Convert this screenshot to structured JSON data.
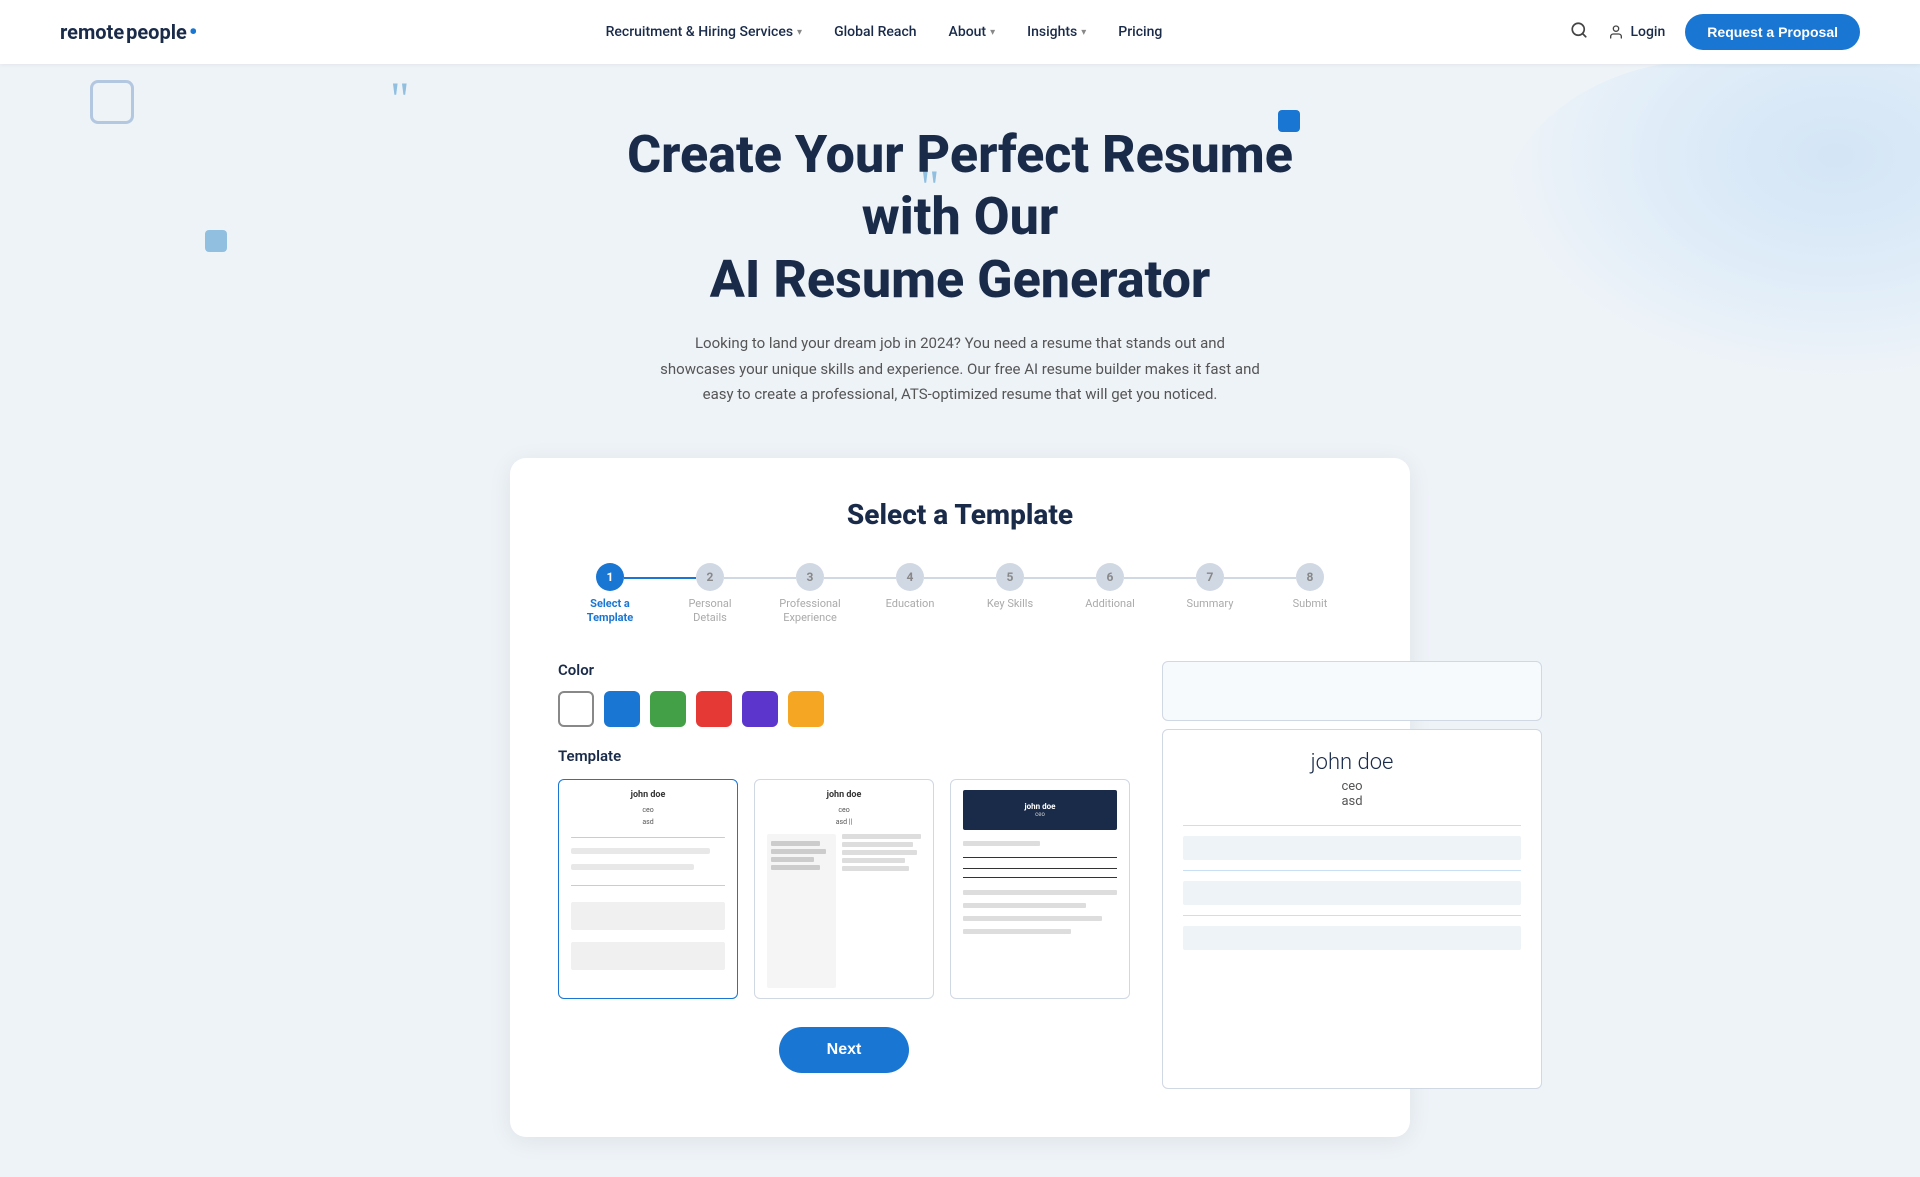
{
  "nav": {
    "logo_remote": "remote",
    "logo_people": "people",
    "links": [
      {
        "label": "Recruitment & Hiring Services",
        "has_dropdown": true
      },
      {
        "label": "Global Reach",
        "has_dropdown": false
      },
      {
        "label": "About",
        "has_dropdown": true
      },
      {
        "label": "Insights",
        "has_dropdown": true
      },
      {
        "label": "Pricing",
        "has_dropdown": false
      }
    ],
    "login_label": "Login",
    "cta_label": "Request a Proposal"
  },
  "hero": {
    "title_line1": "Create Your Perfect Resume with Our",
    "title_line2": "AI Resume Generator",
    "subtitle": "Looking to land your dream job in 2024? You need a resume that stands out and showcases your unique skills and experience. Our free AI resume builder makes it fast and easy to create a professional, ATS-optimized resume that will get you noticed."
  },
  "card": {
    "title": "Select a Template",
    "stepper": {
      "steps": [
        {
          "number": "1",
          "label": "Select a\nTemplate",
          "active": true
        },
        {
          "number": "2",
          "label": "Personal\nDetails",
          "active": false
        },
        {
          "number": "3",
          "label": "Professional\nExperience",
          "active": false
        },
        {
          "number": "4",
          "label": "Education",
          "active": false
        },
        {
          "number": "5",
          "label": "Key Skills",
          "active": false
        },
        {
          "number": "6",
          "label": "Additional",
          "active": false
        },
        {
          "number": "7",
          "label": "Summary",
          "active": false
        },
        {
          "number": "8",
          "label": "Submit",
          "active": false
        }
      ]
    },
    "color_section_label": "Color",
    "colors": [
      {
        "name": "white",
        "value": "#ffffff"
      },
      {
        "name": "blue",
        "value": "#1976d2"
      },
      {
        "name": "green",
        "value": "#43a047"
      },
      {
        "name": "red",
        "value": "#e53935"
      },
      {
        "name": "purple",
        "value": "#5c35cc"
      },
      {
        "name": "orange",
        "value": "#f5a623"
      }
    ],
    "selected_color": "white",
    "template_section_label": "Template",
    "templates": [
      {
        "id": 1,
        "name": "john doe",
        "role": "ceo",
        "company": "asd",
        "selected": true
      },
      {
        "id": 2,
        "name": "john doe",
        "role": "ceo",
        "company": "asd ||",
        "selected": false
      },
      {
        "id": 3,
        "name": "john doe",
        "role": "ceo",
        "selected": false
      }
    ],
    "next_button_label": "Next",
    "preview": {
      "name": "john doe",
      "role": "ceo",
      "company": "asd"
    }
  }
}
